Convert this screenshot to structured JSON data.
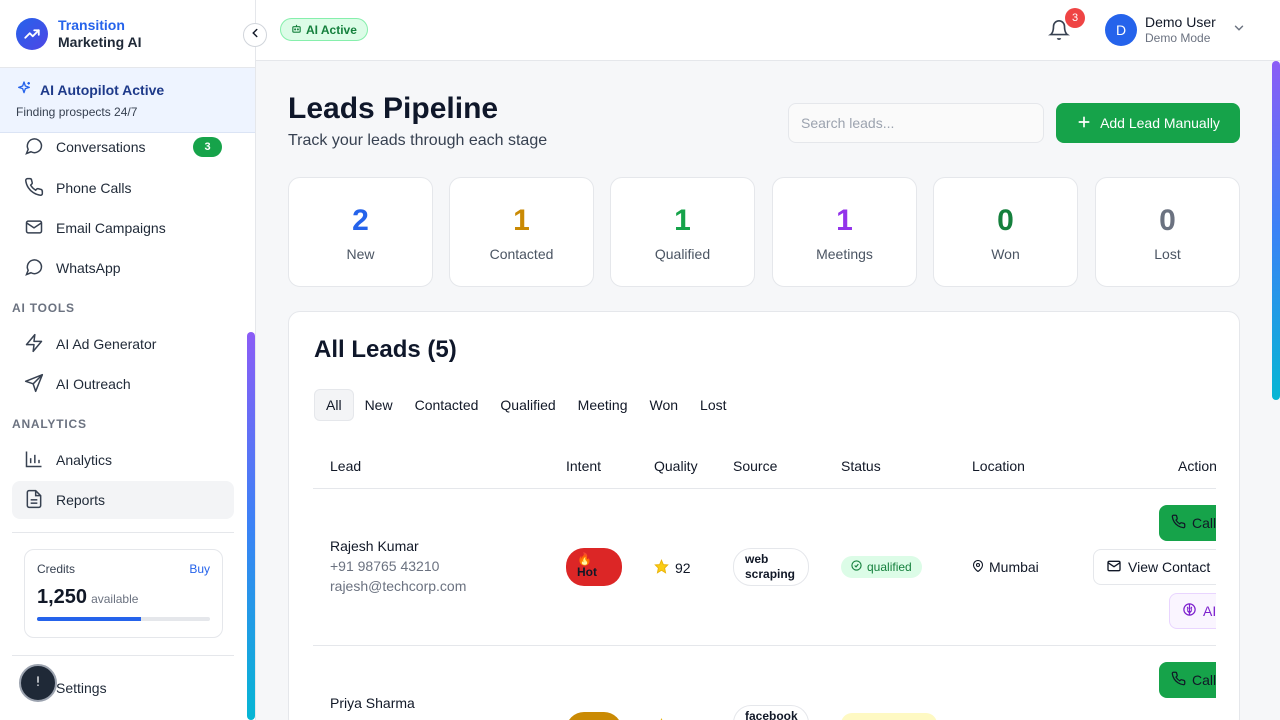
{
  "brand": {
    "line1": "Transition",
    "line2": "Marketing AI"
  },
  "autopilot": {
    "title": "AI Autopilot Active",
    "subtitle": "Finding prospects 24/7"
  },
  "nav": {
    "conversations": {
      "label": "Conversations",
      "badge": "3"
    },
    "phone_calls": "Phone Calls",
    "email_campaigns": "Email Campaigns",
    "whatsapp": "WhatsApp",
    "section_ai_tools": "AI TOOLS",
    "ai_ad_generator": "AI Ad Generator",
    "ai_outreach": "AI Outreach",
    "section_analytics": "ANALYTICS",
    "analytics": "Analytics",
    "reports": "Reports",
    "settings": "Settings"
  },
  "credits": {
    "label": "Credits",
    "buy": "Buy",
    "value": "1,250",
    "unit": "available",
    "fraction": 0.6
  },
  "header": {
    "ai_status": "AI Active",
    "notifications": "3",
    "user": {
      "initial": "D",
      "name": "Demo User",
      "mode": "Demo Mode"
    }
  },
  "page": {
    "title": "Leads Pipeline",
    "subtitle": "Track your leads through each stage"
  },
  "search": {
    "placeholder": "Search leads..."
  },
  "add_button": "Add Lead Manually",
  "stats": [
    {
      "value": "2",
      "label": "New",
      "color": "#2563eb"
    },
    {
      "value": "1",
      "label": "Contacted",
      "color": "#ca8a04"
    },
    {
      "value": "1",
      "label": "Qualified",
      "color": "#16a34a"
    },
    {
      "value": "1",
      "label": "Meetings",
      "color": "#9333ea"
    },
    {
      "value": "0",
      "label": "Won",
      "color": "#15803d"
    },
    {
      "value": "0",
      "label": "Lost",
      "color": "#6b7280"
    }
  ],
  "leads_card": {
    "title": "All Leads (5)",
    "tabs": [
      "All",
      "New",
      "Contacted",
      "Qualified",
      "Meeting",
      "Won",
      "Lost"
    ],
    "columns": [
      "Lead",
      "Intent",
      "Quality",
      "Source",
      "Status",
      "Location",
      "Actions"
    ],
    "rows": [
      {
        "name": "Rajesh Kumar",
        "phone": "+91 98765 43210",
        "email": "rajesh@techcorp.com",
        "intent": "Hot",
        "intent_icon": "🔥",
        "quality": "92",
        "source_1": "web",
        "source_2": "scraping",
        "status": "qualified",
        "location": "Mumbai",
        "action_call": "Call",
        "action_view": "View Contact",
        "action_ai": "AI"
      },
      {
        "name": "Priya Sharma",
        "source_1": "facebook",
        "action_call": "Call"
      }
    ]
  }
}
